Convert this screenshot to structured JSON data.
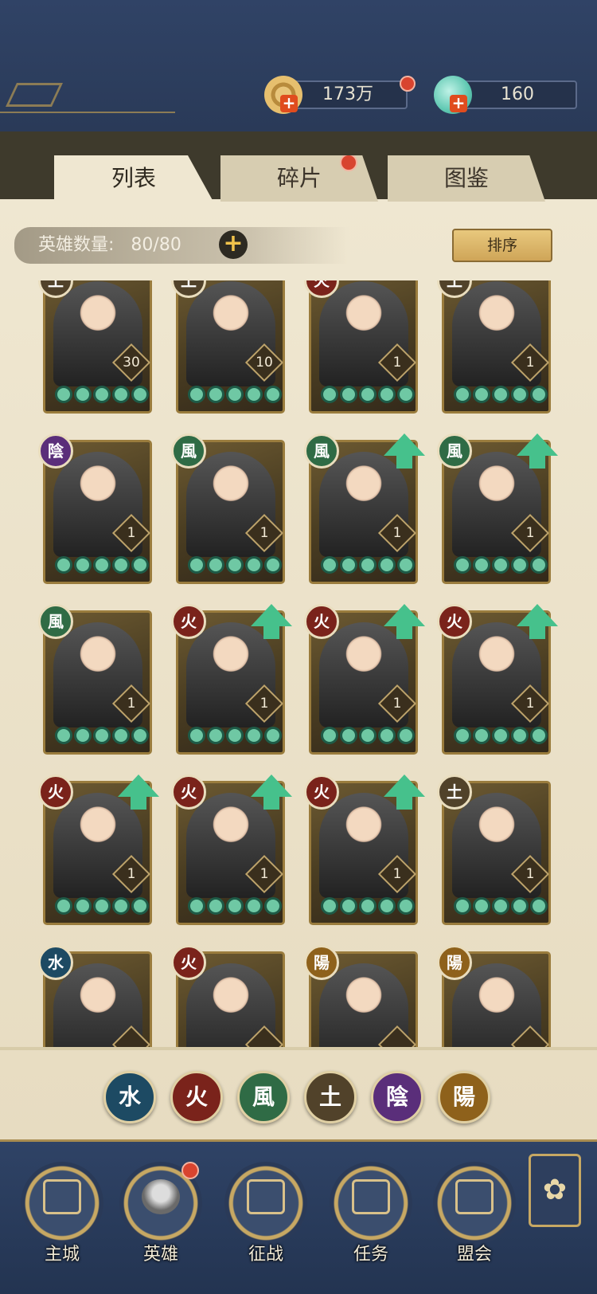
{
  "currency": {
    "coins": "173万",
    "gems": "160"
  },
  "tabs": [
    {
      "label": "列表"
    },
    {
      "label": "碎片"
    },
    {
      "label": "图鉴"
    }
  ],
  "hero_count": {
    "label": "英雄数量:",
    "value": "80/80"
  },
  "sort_label": "排序",
  "cards": [
    {
      "elem": "土",
      "cls": "e-earth",
      "level": "30",
      "up": false
    },
    {
      "elem": "土",
      "cls": "e-earth",
      "level": "10",
      "up": false
    },
    {
      "elem": "火",
      "cls": "e-fire",
      "level": "1",
      "up": false
    },
    {
      "elem": "土",
      "cls": "e-earth",
      "level": "1",
      "up": false
    },
    {
      "elem": "陰",
      "cls": "e-yin",
      "level": "1",
      "up": false
    },
    {
      "elem": "風",
      "cls": "e-wood",
      "level": "1",
      "up": false
    },
    {
      "elem": "風",
      "cls": "e-wood",
      "level": "1",
      "up": true
    },
    {
      "elem": "風",
      "cls": "e-wood",
      "level": "1",
      "up": true
    },
    {
      "elem": "風",
      "cls": "e-wood",
      "level": "1",
      "up": false
    },
    {
      "elem": "火",
      "cls": "e-fire",
      "level": "1",
      "up": true
    },
    {
      "elem": "火",
      "cls": "e-fire",
      "level": "1",
      "up": true
    },
    {
      "elem": "火",
      "cls": "e-fire",
      "level": "1",
      "up": true
    },
    {
      "elem": "火",
      "cls": "e-fire",
      "level": "1",
      "up": true
    },
    {
      "elem": "火",
      "cls": "e-fire",
      "level": "1",
      "up": true
    },
    {
      "elem": "火",
      "cls": "e-fire",
      "level": "1",
      "up": true
    },
    {
      "elem": "土",
      "cls": "e-earth",
      "level": "1",
      "up": false
    },
    {
      "elem": "水",
      "cls": "e-water",
      "level": "",
      "up": false
    },
    {
      "elem": "火",
      "cls": "e-fire",
      "level": "",
      "up": false
    },
    {
      "elem": "陽",
      "cls": "e-yang",
      "level": "",
      "up": false
    },
    {
      "elem": "陽",
      "cls": "e-yang",
      "level": "",
      "up": false
    }
  ],
  "filters": [
    {
      "glyph": "水",
      "cls": "e-water"
    },
    {
      "glyph": "火",
      "cls": "e-fire"
    },
    {
      "glyph": "風",
      "cls": "e-wood"
    },
    {
      "glyph": "土",
      "cls": "e-earth"
    },
    {
      "glyph": "陰",
      "cls": "e-yin"
    },
    {
      "glyph": "陽",
      "cls": "e-yang"
    }
  ],
  "nav": [
    {
      "label": "主城"
    },
    {
      "label": "英雄"
    },
    {
      "label": "征战"
    },
    {
      "label": "任务"
    },
    {
      "label": "盟会"
    }
  ]
}
